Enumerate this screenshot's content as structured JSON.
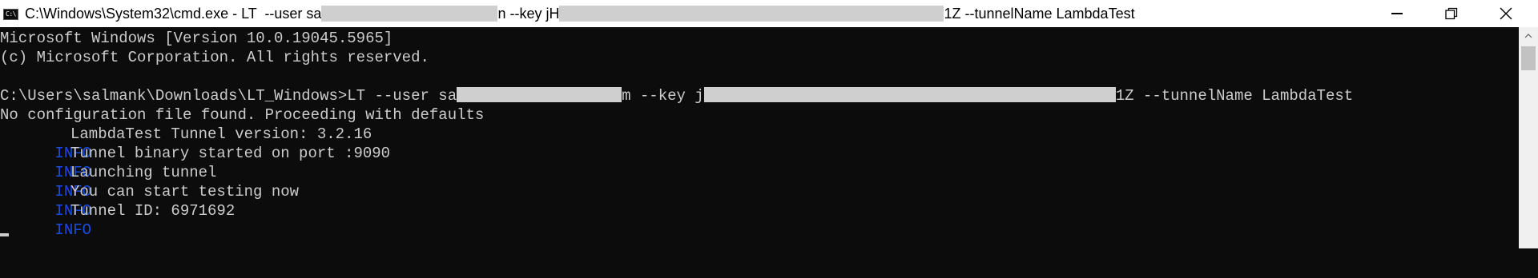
{
  "window": {
    "title_prefix": "C:\\Windows\\System32\\cmd.exe - LT  --user sa",
    "title_middle": "n --key jH",
    "title_suffix": "1Z --tunnelName LambdaTest",
    "icon_label": "C:\\",
    "controls": [
      "minimize",
      "maximize",
      "close"
    ]
  },
  "console": {
    "header_lines": [
      "Microsoft Windows [Version 10.0.19045.5965]",
      "(c) Microsoft Corporation. All rights reserved."
    ],
    "command": {
      "prompt": "C:\\Users\\salmank\\Downloads\\LT_Windows>LT --user sa",
      "part2": "m --key j",
      "part3": "1Z --tunnelName LambdaTest"
    },
    "config_notice": "No configuration file found. Proceeding with defaults",
    "log": [
      {
        "level": "INFO",
        "message": "LambdaTest Tunnel version: 3.2.16"
      },
      {
        "level": "INFO",
        "message": "Tunnel binary started on port :9090"
      },
      {
        "level": "INFO",
        "message": "Launching tunnel"
      },
      {
        "level": "INFO",
        "message": "You can start testing now"
      },
      {
        "level": "INFO",
        "message": "Tunnel ID: 6971692"
      }
    ]
  },
  "colors": {
    "console_background": "#0c0c0c",
    "console_text": "#cccccc",
    "info_level": "#1a4ce0",
    "redaction": "#cfcfcf"
  }
}
